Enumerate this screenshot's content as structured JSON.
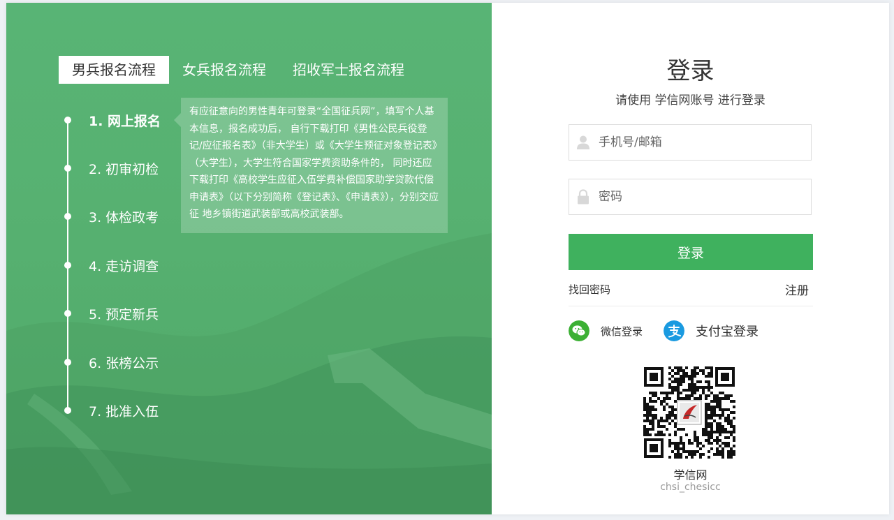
{
  "tabs": [
    {
      "label": "男兵报名流程",
      "active": true
    },
    {
      "label": "女兵报名流程",
      "active": false
    },
    {
      "label": "招收军士报名流程",
      "active": false
    }
  ],
  "steps": [
    {
      "label": "1. 网上报名",
      "active": true
    },
    {
      "label": "2. 初审初检",
      "active": false
    },
    {
      "label": "3. 体检政考",
      "active": false
    },
    {
      "label": "4. 走访调查",
      "active": false
    },
    {
      "label": "5. 预定新兵",
      "active": false
    },
    {
      "label": "6. 张榜公示",
      "active": false
    },
    {
      "label": "7. 批准入伍",
      "active": false
    }
  ],
  "step_description": "有应征意向的男性青年可登录“全国征兵网”，填写个人基本信息，报名成功后， 自行下载打印《男性公民兵役登记/应征报名表》（非大学生）或《大学生预征对象登记表》（大学生），大学生符合国家学费资助条件的， 同时还应下载打印《高校学生应征入伍学费补偿国家助学贷款代偿申请表》（以下分别简称《登记表》、《申请表》），分别交应征 地乡镇街道武装部或高校武装部。",
  "login": {
    "title": "登录",
    "subtitle": "请使用 学信网账号 进行登录",
    "username_placeholder": "手机号/邮箱",
    "password_placeholder": "密码",
    "submit_label": "登录",
    "forgot_label": "找回密码",
    "register_label": "注册"
  },
  "social": {
    "wechat_label": "微信登录",
    "alipay_label": "支付宝登录",
    "wechat_color": "#3cb034",
    "alipay_color": "#1a9ae0"
  },
  "qr": {
    "name": "学信网",
    "account": "chsi_chesicc"
  },
  "colors": {
    "panel_green": "#56b272",
    "button_green": "#3fb15e"
  }
}
